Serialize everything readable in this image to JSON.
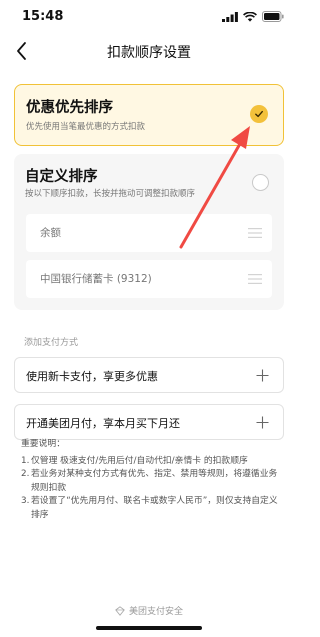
{
  "status": {
    "time": "15:48"
  },
  "nav": {
    "title": "扣款顺序设置"
  },
  "discount_option": {
    "title": "优惠优先排序",
    "description": "优先使用当笔最优惠的方式扣款",
    "selected": true
  },
  "custom_option": {
    "title": "自定义排序",
    "description": "按以下顺序扣款，长按并拖动可调整扣款顺序",
    "selected": false,
    "items": [
      {
        "label": "余额"
      },
      {
        "label": "中国银行储蓄卡 (9312)"
      }
    ]
  },
  "add_payment": {
    "section_label": "添加支付方式",
    "actions": [
      {
        "label": "使用新卡支付，享更多优惠"
      },
      {
        "label": "开通美团月付，享本月买下月还"
      }
    ]
  },
  "notes": {
    "title": "重要说明：",
    "items": [
      {
        "num": "1.",
        "text": "仅管理 极速支付/先用后付/自动代扣/亲情卡 的扣款顺序"
      },
      {
        "num": "2.",
        "text": "若业务对某种支付方式有优先、指定、禁用等规则，将遵循业务规则扣款"
      },
      {
        "num": "3.",
        "text": "若设置了“优先用月付、联名卡或数字人民币”，则仅支持自定义排序"
      }
    ]
  },
  "footer": {
    "text": "美团支付安全"
  },
  "colors": {
    "accent": "#f3c13b",
    "selected_bg": "#fff8e3",
    "annotation_arrow": "#f04a43"
  }
}
